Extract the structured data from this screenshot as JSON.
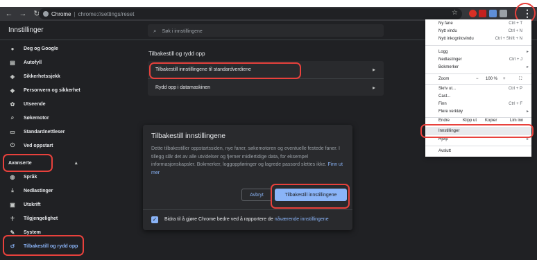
{
  "browser": {
    "chip": "Chrome",
    "url": "chrome://settings/reset",
    "nav_back": "←",
    "nav_forward": "→",
    "nav_reload": "↻",
    "star": "☆",
    "menu_dots": "⋮"
  },
  "header": {
    "title": "Innstillinger",
    "search_placeholder": "Søk i innstillingene"
  },
  "sidebar": {
    "items": [
      {
        "label": "Deg og Google"
      },
      {
        "label": "Autofyll"
      },
      {
        "label": "Sikkerhetssjekk"
      },
      {
        "label": "Personvern og sikkerhet"
      },
      {
        "label": "Utseende"
      },
      {
        "label": "Søkemotor"
      },
      {
        "label": "Standardnettleser"
      },
      {
        "label": "Ved oppstart"
      }
    ],
    "advanced": "Avanserte",
    "adv_items": [
      {
        "label": "Språk"
      },
      {
        "label": "Nedlastinger"
      },
      {
        "label": "Utskrift"
      },
      {
        "label": "Tilgjengelighet"
      },
      {
        "label": "System"
      },
      {
        "label": "Tilbakestill og rydd opp"
      }
    ]
  },
  "main": {
    "section_title": "Tilbakestill og rydd opp",
    "rows": [
      {
        "label": "Tilbakestill innstillingene til standardverdiene"
      },
      {
        "label": "Rydd opp i datamaskinen"
      }
    ]
  },
  "dialog": {
    "title": "Tilbakestill innstillingene",
    "body": "Dette tilbakestiller oppstartssiden, nye faner, søkemotoren og eventuelle festede faner. I tillegg slår det av alle utvidelser og fjerner midlertidige data, for eksempel informasjonskapsler. Bokmerker, loggoppføringer og lagrede passord slettes ikke.",
    "link": "Finn ut mer",
    "cancel": "Avbryt",
    "confirm": "Tilbakestill innstillingene",
    "footer_text": "Bidra til å gjøre Chrome bedre ved å rapportere de ",
    "footer_link": "nåværende innstillingene",
    "checkbox_checked": true
  },
  "menu": {
    "items": [
      {
        "label": "Ny fane",
        "shortcut": "Ctrl + T"
      },
      {
        "label": "Nytt vindu",
        "shortcut": "Ctrl + N"
      },
      {
        "label": "Nytt inkognitovindu",
        "shortcut": "Ctrl + Shift + N"
      },
      {
        "label": "Logg",
        "shortcut": ""
      },
      {
        "label": "Nedlastinger",
        "shortcut": "Ctrl + J"
      },
      {
        "label": "Bokmerker",
        "shortcut": ""
      },
      {
        "label": "Skriv ut...",
        "shortcut": "Ctrl + P"
      },
      {
        "label": "Cast...",
        "shortcut": ""
      },
      {
        "label": "Finn",
        "shortcut": "Ctrl + F"
      },
      {
        "label": "Flere verktøy",
        "shortcut": ""
      },
      {
        "label": "Innstillinger",
        "shortcut": ""
      },
      {
        "label": "Hjelp",
        "shortcut": ""
      },
      {
        "label": "Avslutt",
        "shortcut": ""
      }
    ],
    "zoom_label": "Zoom",
    "zoom_minus": "−",
    "zoom_value": "100 %",
    "zoom_plus": "+",
    "zoom_fullscreen": "⛶",
    "edit_label": "Endre",
    "edit_cut": "Klipp ut",
    "edit_copy": "Kopier",
    "edit_paste": "Lim inn"
  },
  "colors": {
    "accent": "#8ab4f8",
    "highlight_ring": "#e8413c",
    "page_bg": "#202124"
  }
}
